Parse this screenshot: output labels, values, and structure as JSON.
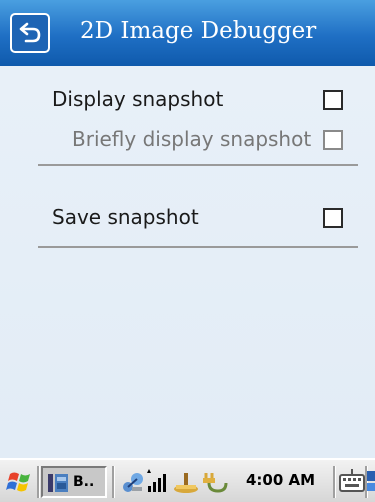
{
  "window": {
    "title": "2D Image Debugger",
    "back_icon": "back-arrow-icon"
  },
  "options": [
    {
      "label": "Display snapshot",
      "checked": false,
      "enabled": true
    },
    {
      "label": "Briefly display snapshot",
      "checked": false,
      "enabled": false
    },
    {
      "label": "Save snapshot",
      "checked": false,
      "enabled": true
    }
  ],
  "taskbar": {
    "start_icon": "windows-flag-icon",
    "app_button_label": "B..",
    "tray_icons": [
      "network-icon",
      "signal-strength-icon",
      "volume-icon",
      "power-plug-icon"
    ],
    "clock": "4:00 AM",
    "keyboard_icon": "keyboard-icon",
    "switch_icon": "window-switch-icon"
  },
  "colors": {
    "title_bar": "#1f6fc4",
    "content_bg": "#e6eef7",
    "taskbar": "#dcdcdc"
  }
}
